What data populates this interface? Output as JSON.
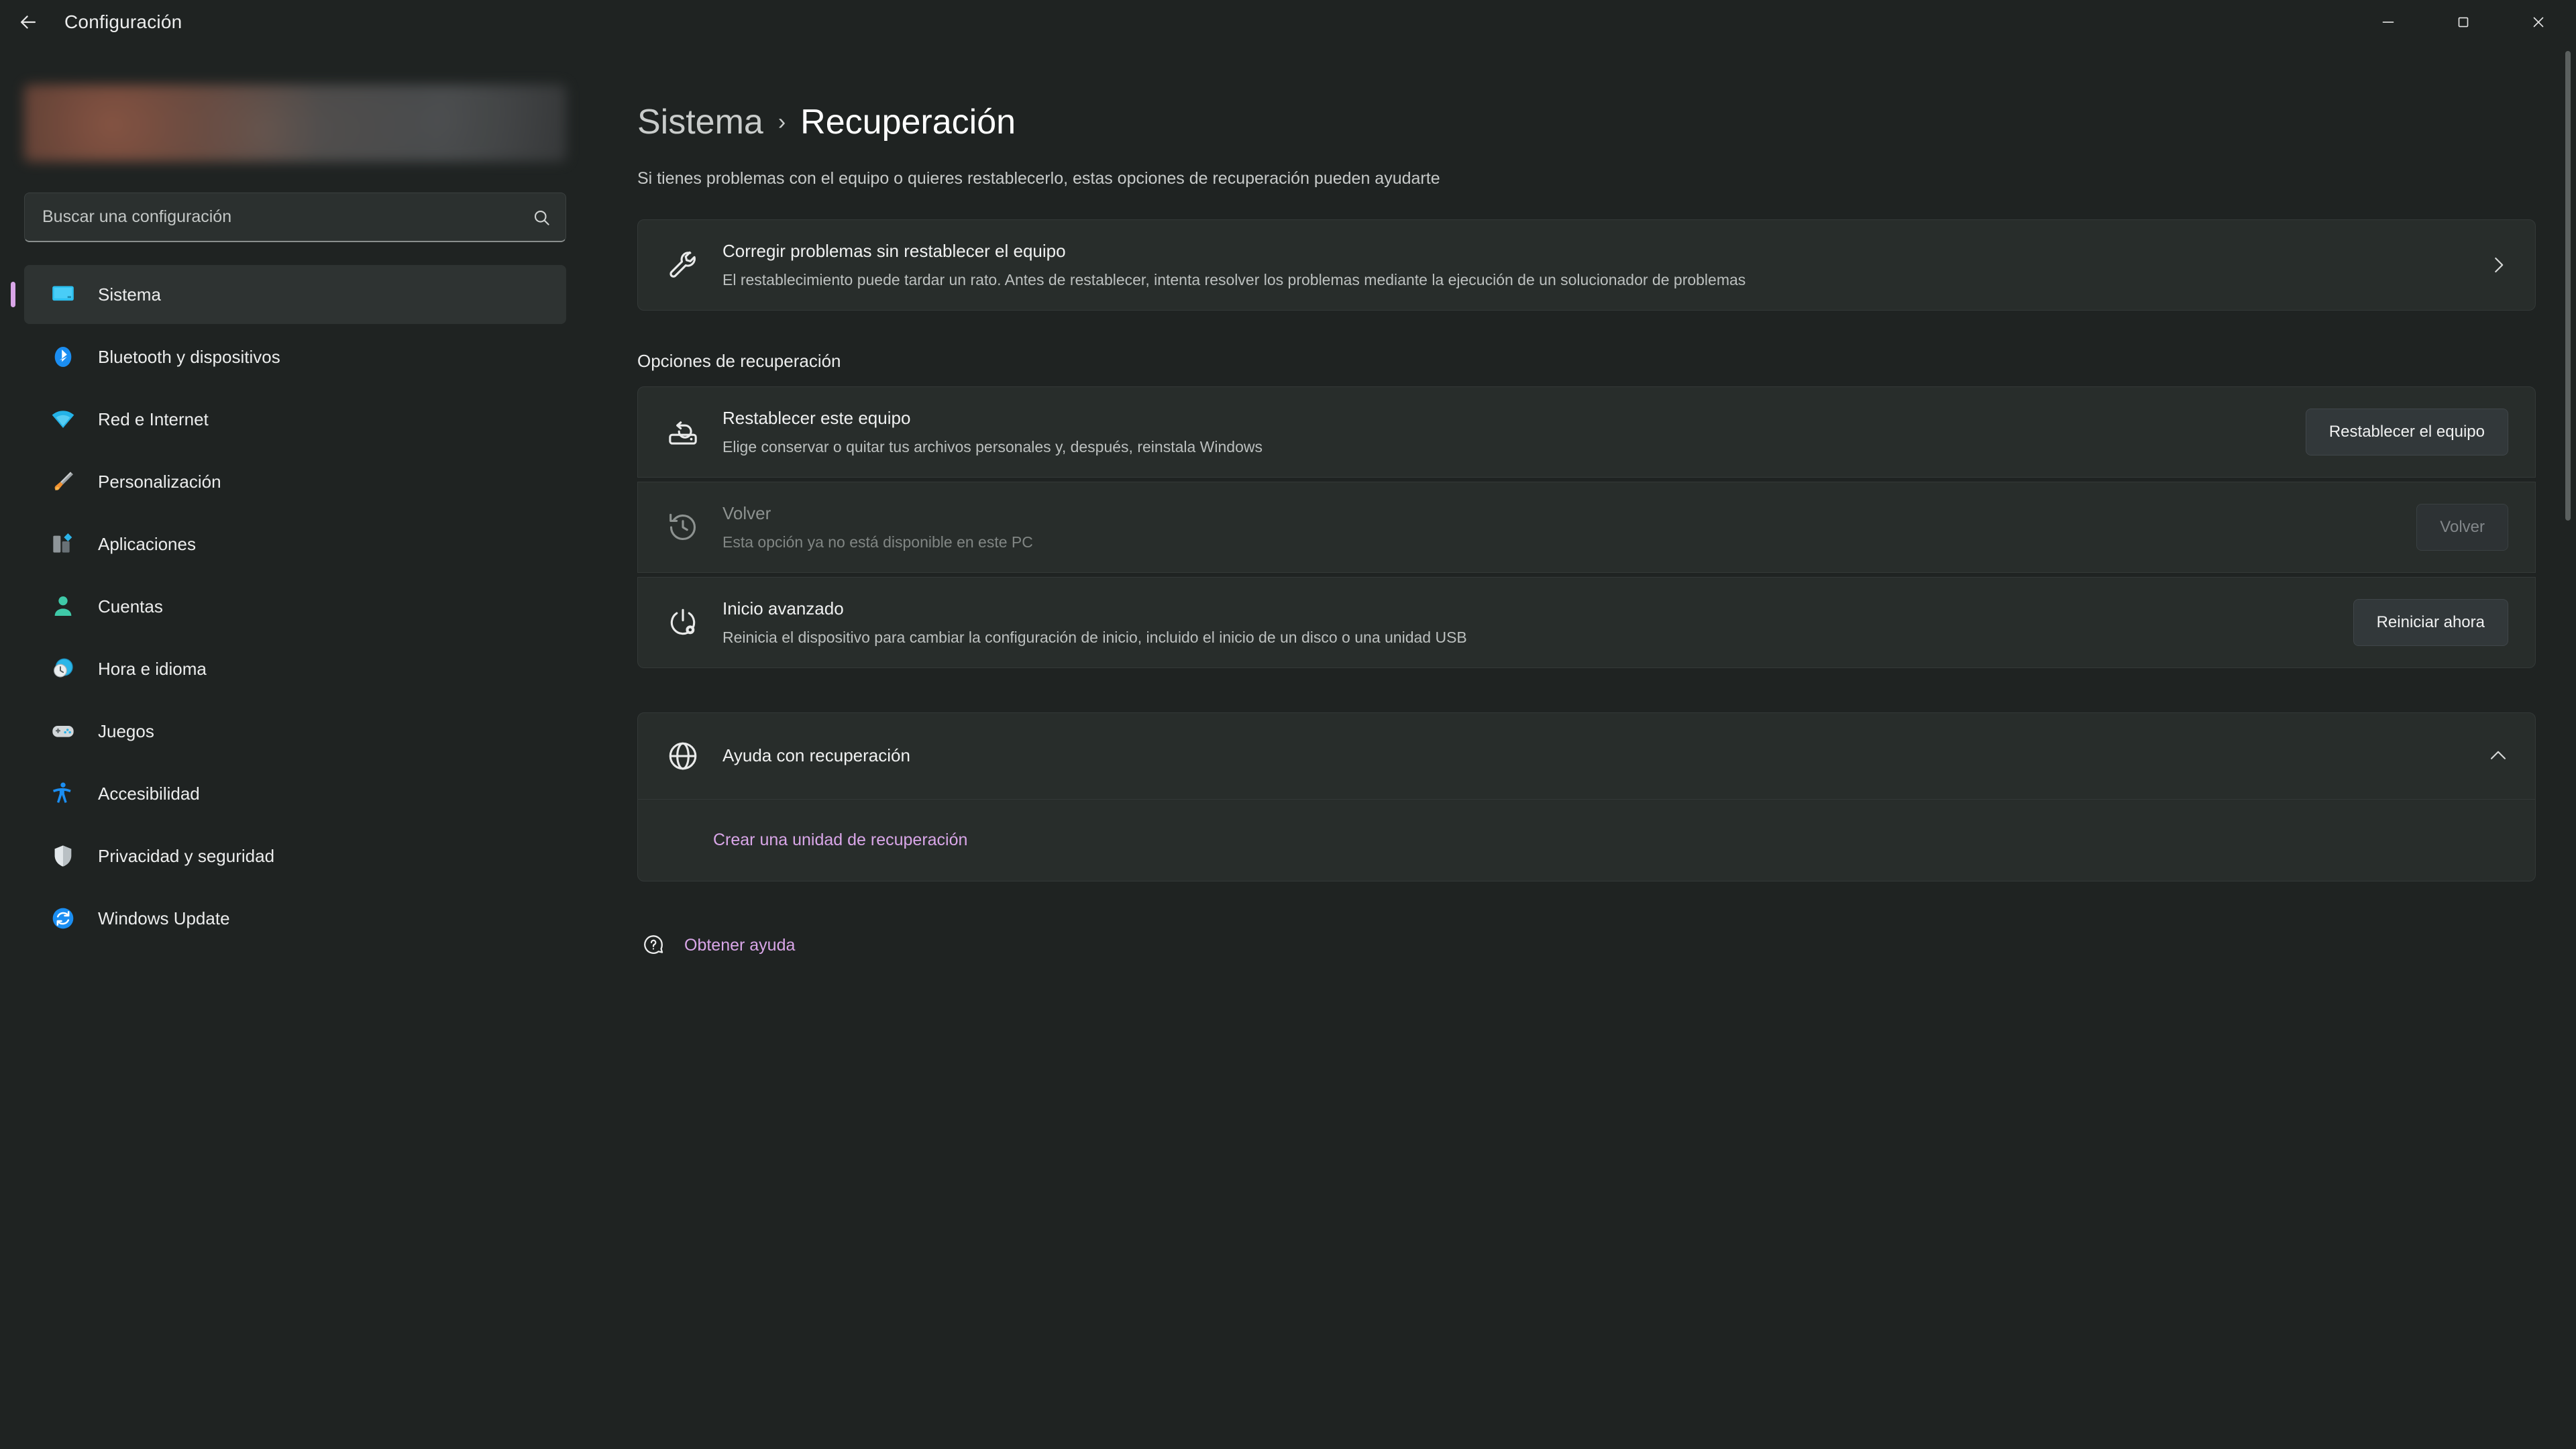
{
  "window": {
    "title": "Configuración",
    "back_icon": "arrow-left-icon",
    "minimize_label": "Minimizar",
    "maximize_label": "Maximizar",
    "close_label": "Cerrar"
  },
  "sidebar": {
    "search": {
      "placeholder": "Buscar una configuración",
      "value": "",
      "icon": "search-icon"
    },
    "items": [
      {
        "label": "Sistema",
        "icon": "system-icon",
        "selected": true
      },
      {
        "label": "Bluetooth y dispositivos",
        "icon": "bluetooth-icon",
        "selected": false
      },
      {
        "label": "Red e Internet",
        "icon": "wifi-icon",
        "selected": false
      },
      {
        "label": "Personalización",
        "icon": "paintbrush-icon",
        "selected": false
      },
      {
        "label": "Aplicaciones",
        "icon": "apps-icon",
        "selected": false
      },
      {
        "label": "Cuentas",
        "icon": "account-icon",
        "selected": false
      },
      {
        "label": "Hora e idioma",
        "icon": "clock-globe-icon",
        "selected": false
      },
      {
        "label": "Juegos",
        "icon": "gamepad-icon",
        "selected": false
      },
      {
        "label": "Accesibilidad",
        "icon": "accessibility-icon",
        "selected": false
      },
      {
        "label": "Privacidad y seguridad",
        "icon": "shield-icon",
        "selected": false
      },
      {
        "label": "Windows Update",
        "icon": "update-icon",
        "selected": false
      }
    ]
  },
  "main": {
    "breadcrumb": {
      "parent": "Sistema",
      "separator": "›",
      "current": "Recuperación"
    },
    "description": "Si tienes problemas con el equipo o quieres restablecerlo, estas opciones de recuperación pueden ayudarte",
    "troubleshoot_card": {
      "icon": "wrench-icon",
      "title": "Corregir problemas sin restablecer el equipo",
      "subtitle": "El restablecimiento puede tardar un rato. Antes de restablecer, intenta resolver los problemas mediante la ejecución de un solucionador de problemas",
      "chevron": "chevron-right-icon"
    },
    "section_title": "Opciones de recuperación",
    "options": [
      {
        "icon": "reset-pc-icon",
        "title": "Restablecer este equipo",
        "subtitle": "Elige conservar o quitar tus archivos personales y, después, reinstala Windows",
        "button": "Restablecer el equipo",
        "disabled": false
      },
      {
        "icon": "history-back-icon",
        "title": "Volver",
        "subtitle": "Esta opción ya no está disponible en este PC",
        "button": "Volver",
        "disabled": true
      },
      {
        "icon": "advanced-startup-icon",
        "title": "Inicio avanzado",
        "subtitle": "Reinicia el dispositivo para cambiar la configuración de inicio, incluido el inicio de un disco o una unidad USB",
        "button": "Reiniciar ahora",
        "disabled": false
      }
    ],
    "help_expander": {
      "icon": "globe-icon",
      "title": "Ayuda con recuperación",
      "chevron": "chevron-up-icon",
      "expanded": true,
      "links": [
        {
          "label": "Crear una unidad de recuperación"
        }
      ]
    },
    "footer_links": [
      {
        "label": "Obtener ayuda",
        "icon": "help-question-icon"
      }
    ]
  },
  "colors": {
    "accent": "#d9a6e8",
    "card_bg": "#282d2b",
    "page_bg": "#1f2322"
  }
}
